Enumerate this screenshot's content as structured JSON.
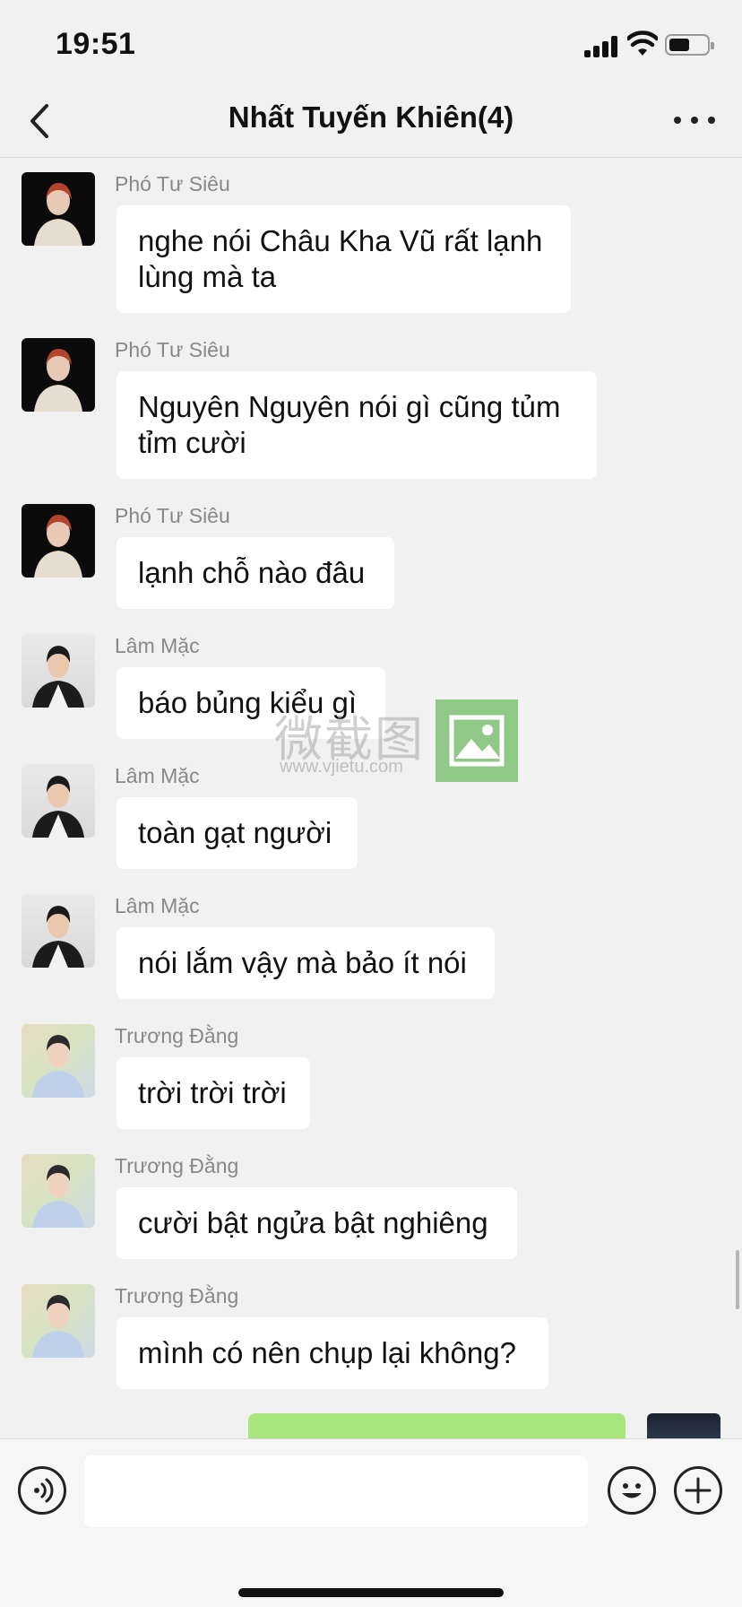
{
  "status_bar": {
    "time": "19:51"
  },
  "header": {
    "title": "Nhất Tuyến Khiên(4)"
  },
  "messages": [
    {
      "sender": "Phó Tư Siêu",
      "text": "nghe nói Châu Kha Vũ rất lạnh lùng mà ta"
    },
    {
      "sender": "Phó Tư Siêu",
      "text": "Nguyên Nguyên nói gì cũng tủm tỉm cười"
    },
    {
      "sender": "Phó Tư Siêu",
      "text": "lạnh chỗ nào đâu"
    },
    {
      "sender": "Lâm Mặc",
      "text": "báo bủng kiểu gì"
    },
    {
      "sender": "Lâm Mặc",
      "text": "toàn gạt người"
    },
    {
      "sender": "Lâm Mặc",
      "text": "nói lắm vậy mà bảo ít nói"
    },
    {
      "sender": "Trương Đằng",
      "text": "trời trời trời"
    },
    {
      "sender": "Trương Đằng",
      "text": "cười bật ngửa bật nghiêng"
    },
    {
      "sender": "Trương Đằng",
      "text": "mình có nên chụp lại không?"
    }
  ],
  "watermark": {
    "text": "微截图",
    "url": "www.vjietu.com"
  },
  "icons": {
    "back": "chevron-left-icon",
    "more": "more-dots-icon",
    "voice": "voice-icon",
    "emoji": "emoji-icon",
    "plus": "plus-icon"
  },
  "colors": {
    "background": "#f1f1f1",
    "my_bubble": "#a9e67e",
    "other_bubble": "#ffffff"
  }
}
